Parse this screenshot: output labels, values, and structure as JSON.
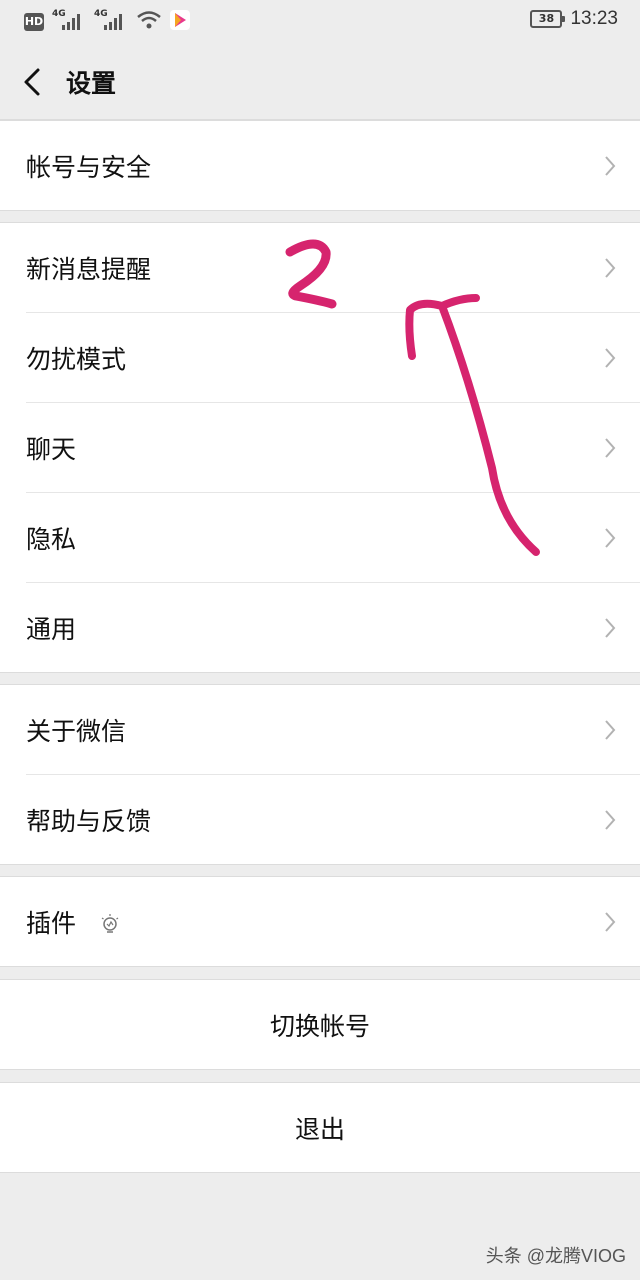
{
  "status_bar": {
    "hd": "HD",
    "network_1": "4G",
    "network_2": "4G",
    "battery": "38",
    "time": "13:23"
  },
  "header": {
    "title": "设置"
  },
  "groups": [
    {
      "items": [
        {
          "label": "帐号与安全"
        }
      ]
    },
    {
      "items": [
        {
          "label": "新消息提醒"
        },
        {
          "label": "勿扰模式"
        },
        {
          "label": "聊天"
        },
        {
          "label": "隐私"
        },
        {
          "label": "通用"
        }
      ]
    },
    {
      "items": [
        {
          "label": "关于微信"
        },
        {
          "label": "帮助与反馈"
        }
      ]
    },
    {
      "items": [
        {
          "label": "插件"
        }
      ]
    }
  ],
  "actions": {
    "switch_account": "切换帐号",
    "logout": "退出"
  },
  "annotation": {
    "number": "2",
    "color": "#d6246e"
  },
  "watermark": "头条 @龙腾VIOG"
}
